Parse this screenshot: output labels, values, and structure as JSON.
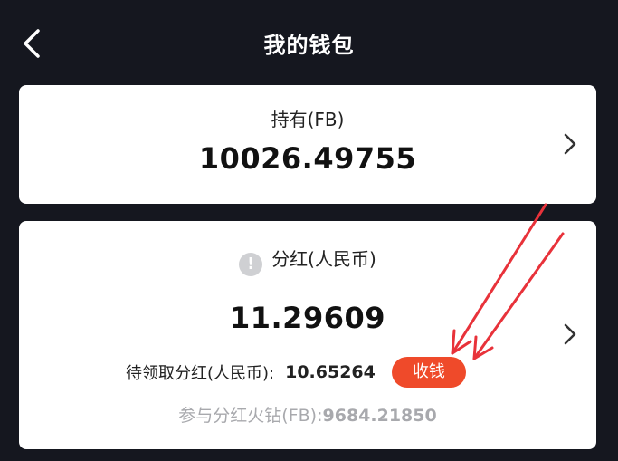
{
  "header": {
    "title": "我的钱包",
    "back_icon": "chevron-left-icon"
  },
  "holdings": {
    "label": "持有(FB)",
    "value": "10026.49755"
  },
  "dividend": {
    "info_icon_glyph": "!",
    "label": "分红(人民币)",
    "value": "11.29609",
    "pending_label": "待领取分红(人民币):",
    "pending_value": "10.65264",
    "collect_label": "收钱",
    "participate_label": "参与分红火钻(FB):",
    "participate_value": "9684.21850"
  },
  "colors": {
    "background": "#15171f",
    "card": "#ffffff",
    "accent": "#ef4a2a",
    "muted_text": "#a8a9ad",
    "annotation_arrow": "#e8323a"
  }
}
